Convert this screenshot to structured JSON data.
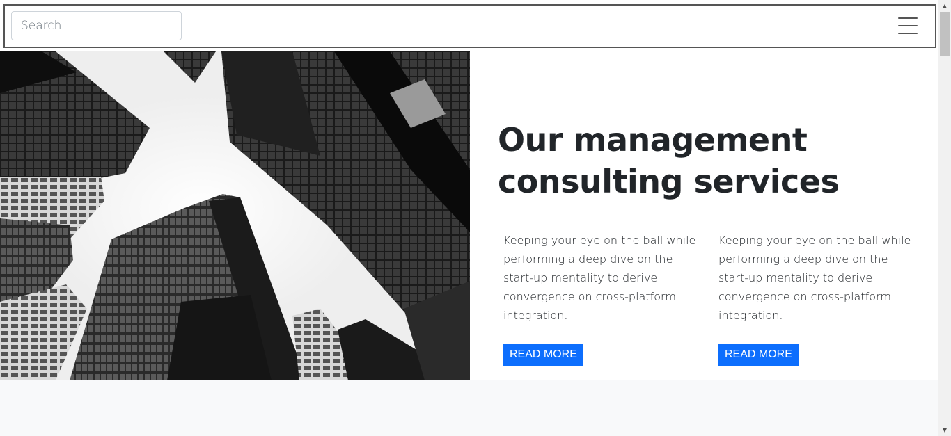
{
  "navbar": {
    "search": {
      "placeholder": "Search",
      "value": ""
    },
    "menu_icon": "hamburger-menu-icon"
  },
  "hero": {
    "image_alt": "Black-and-white upward view of skyscrapers",
    "title": "Our management consulting services",
    "columns": [
      {
        "text": "Keeping your eye on the ball while performing a deep dive on the start-up mentality to derive convergence on cross-platform integration.",
        "button_label": "READ MORE"
      },
      {
        "text": "Keeping your eye on the ball while performing a deep dive on the start-up mentality to derive convergence on cross-platform integration.",
        "button_label": "READ MORE"
      }
    ]
  },
  "scrollbar": {
    "up_icon": "▲",
    "down_icon": "▼"
  },
  "colors": {
    "accent": "#0d6efd",
    "text": "#212529",
    "band_background": "#f8f9fa"
  }
}
